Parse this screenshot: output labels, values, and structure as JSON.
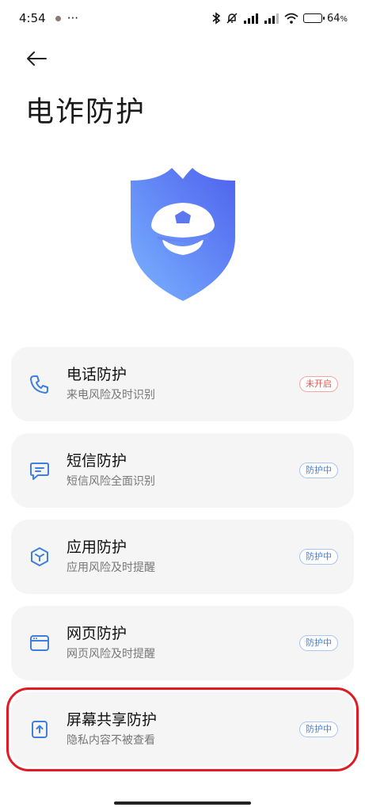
{
  "status_bar": {
    "time": "4:54",
    "more": "···",
    "battery": "64",
    "battery_unit": "%"
  },
  "page": {
    "title": "电诈防护"
  },
  "cards": [
    {
      "title": "电话防护",
      "subtitle": "来电风险及时识别",
      "badge": "未开启",
      "status": "off",
      "icon": "phone-icon"
    },
    {
      "title": "短信防护",
      "subtitle": "短信风险全面识别",
      "badge": "防护中",
      "status": "on",
      "icon": "message-icon"
    },
    {
      "title": "应用防护",
      "subtitle": "应用风险及时提醒",
      "badge": "防护中",
      "status": "on",
      "icon": "app-hexagon-icon"
    },
    {
      "title": "网页防护",
      "subtitle": "网页风险及时提醒",
      "badge": "防护中",
      "status": "on",
      "icon": "browser-window-icon"
    },
    {
      "title": "屏幕共享防护",
      "subtitle": "隐私内容不被查看",
      "badge": "防护中",
      "status": "on",
      "icon": "screen-share-icon"
    }
  ],
  "colors": {
    "accent": "#3e7fe0",
    "badge_off": "#e0574f",
    "highlight": "#e01b24",
    "card_bg": "#f5f5f5"
  }
}
